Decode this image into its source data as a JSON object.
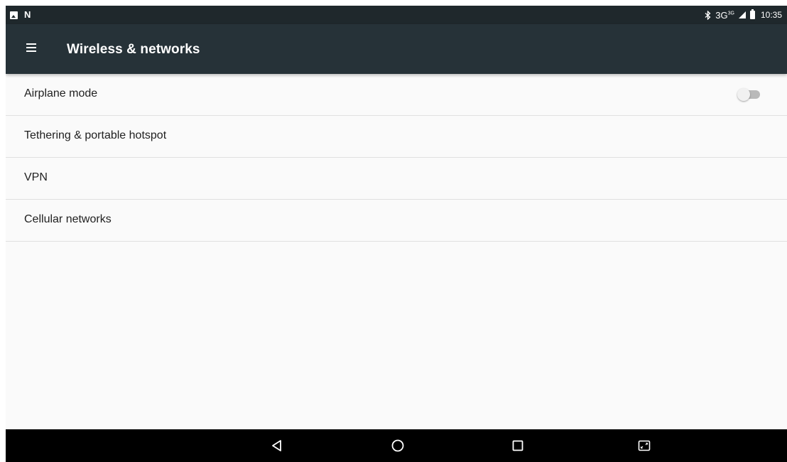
{
  "status_bar": {
    "left_icons": [
      "image-notification-icon",
      "n-notification-icon"
    ],
    "n_glyph": "N",
    "network_type": "3G",
    "network_sub": "3G",
    "time": "10:35"
  },
  "app_bar": {
    "title": "Wireless & networks",
    "menu_icon": "hamburger-menu-icon"
  },
  "settings": {
    "items": [
      {
        "label": "Airplane mode",
        "has_toggle": true,
        "toggle_on": false
      },
      {
        "label": "Tethering & portable hotspot"
      },
      {
        "label": "VPN"
      },
      {
        "label": "Cellular networks"
      }
    ]
  },
  "nav_bar": {
    "buttons": [
      "back-icon",
      "home-icon",
      "recents-icon",
      "screenshot-icon"
    ]
  },
  "colors": {
    "status_bar": "#1f282c",
    "app_bar": "#263238",
    "background": "#fafafa",
    "divider": "#e0e0e0",
    "nav_bar": "#000000"
  }
}
